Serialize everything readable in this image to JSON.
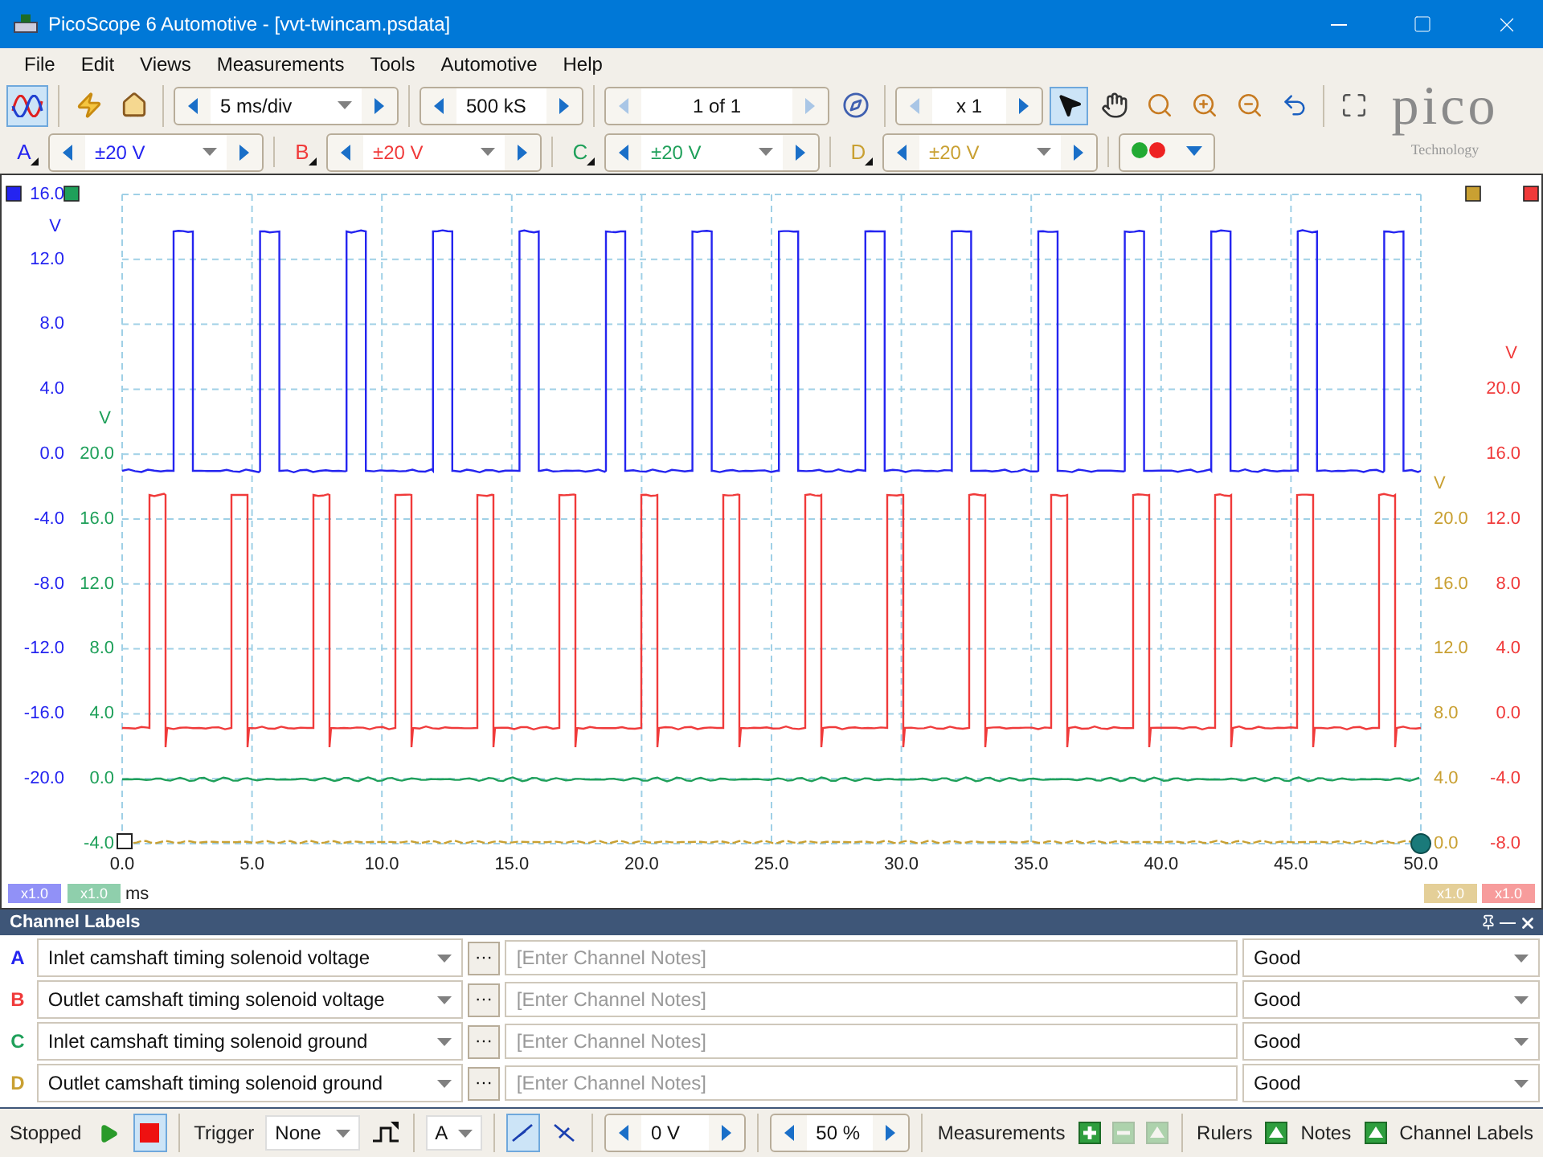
{
  "window": {
    "title": "PicoScope 6 Automotive - [vvt-twincam.psdata]"
  },
  "menu": [
    "File",
    "Edit",
    "Views",
    "Measurements",
    "Tools",
    "Automotive",
    "Help"
  ],
  "toolbar": {
    "mode_selected": true,
    "timebase": {
      "value": "5 ms/div"
    },
    "samples": {
      "value": "500 kS"
    },
    "buffer": {
      "value": "1 of 1",
      "prev_disabled": true,
      "next_disabled": true
    },
    "zoom": {
      "value": "x 1",
      "prev_disabled": true,
      "next_disabled": false
    },
    "tools": [
      {
        "kind": "pointer",
        "selected": true
      },
      {
        "kind": "hand",
        "selected": false
      },
      {
        "kind": "zoom_region",
        "selected": false
      },
      {
        "kind": "zoom_in",
        "selected": false
      },
      {
        "kind": "zoom_out",
        "selected": false
      },
      {
        "kind": "undo",
        "selected": false
      },
      {
        "kind": "zoom_fit",
        "selected": false
      }
    ],
    "logo": {
      "name": "pico",
      "tagline": "Technology"
    }
  },
  "channels": [
    {
      "letter": "A",
      "color": "#2424f0",
      "range": "±20 V"
    },
    {
      "letter": "B",
      "color": "#f03a3a",
      "range": "±20 V"
    },
    {
      "letter": "C",
      "color": "#1fa05a",
      "range": "±20 V"
    },
    {
      "letter": "D",
      "color": "#c9a032",
      "range": "±20 V"
    }
  ],
  "scope": {
    "left_axes": [
      {
        "kind": "top",
        "color": "#2424f0",
        "unit": "V",
        "scale": "x1.0",
        "ticks": [
          "16.0",
          "12.0",
          "8.0",
          "4.0",
          "0.0",
          "-4.0",
          "-8.0",
          "-12.0",
          "-16.0",
          "-20.0"
        ]
      },
      {
        "kind": "bottom",
        "color": "#1fa05a",
        "unit": "V",
        "scale": "x1.0",
        "ticks": [
          "20.0",
          "16.0",
          "12.0",
          "8.0",
          "4.0",
          "0.0",
          "-4.0"
        ]
      }
    ],
    "right_axes": [
      {
        "kind": "bottom",
        "color": "#c9a032",
        "unit": "V",
        "scale": "x1.0",
        "ticks": [
          "20.0",
          "16.0",
          "12.0",
          "8.0",
          "4.0",
          "0.0"
        ]
      },
      {
        "kind": "bottom",
        "color": "#f03a3a",
        "unit": "V",
        "scale": "x1.0",
        "ticks": [
          "20.0",
          "16.0",
          "12.0",
          "8.0",
          "4.0",
          "0.0",
          "-4.0",
          "-8.0"
        ]
      }
    ],
    "time_axis": {
      "unit": "ms",
      "ticks": [
        "0.0",
        "5.0",
        "10.0",
        "15.0",
        "20.0",
        "25.0",
        "30.0",
        "35.0",
        "40.0",
        "45.0",
        "50.0"
      ]
    }
  },
  "channel_labels": {
    "title": "Channel Labels",
    "rows": [
      {
        "letter": "A",
        "label": "Inlet camshaft timing solenoid voltage",
        "more": "···",
        "notes_placeholder": "[Enter Channel Notes]",
        "quality": "Good"
      },
      {
        "letter": "B",
        "label": "Outlet camshaft timing solenoid voltage",
        "more": "···",
        "notes_placeholder": "[Enter Channel Notes]",
        "quality": "Good"
      },
      {
        "letter": "C",
        "label": "Inlet camshaft timing solenoid ground",
        "more": "···",
        "notes_placeholder": "[Enter Channel Notes]",
        "quality": "Good"
      },
      {
        "letter": "D",
        "label": "Outlet camshaft timing solenoid ground",
        "more": "···",
        "notes_placeholder": "[Enter Channel Notes]",
        "quality": "Good"
      }
    ]
  },
  "status_bar": {
    "state": "Stopped",
    "running": false,
    "trigger_label": "Trigger",
    "trigger_mode": "None",
    "trigger_source": "A",
    "edges": [
      {
        "kind": "rising",
        "selected": true
      },
      {
        "kind": "falling",
        "selected": false
      }
    ],
    "threshold": "0 V",
    "pretrigger": "50 %",
    "measurements_label": "Measurements",
    "measurement_buttons": [
      {
        "kind": "add",
        "disabled": false
      },
      {
        "kind": "remove",
        "disabled": true
      },
      {
        "kind": "edit",
        "disabled": true
      }
    ],
    "rulers_label": "Rulers",
    "notes_label": "Notes",
    "channel_labels_label": "Channel Labels"
  }
}
